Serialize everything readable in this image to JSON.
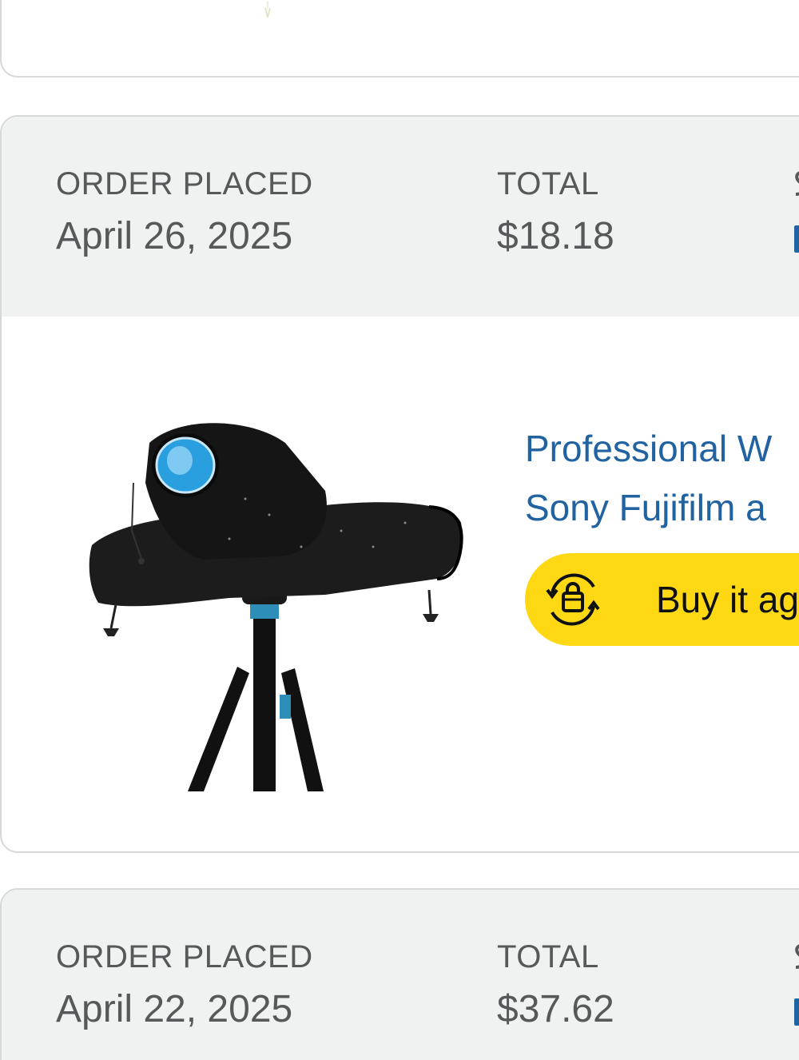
{
  "orders": [
    {
      "order_placed_label": "ORDER PLACED",
      "order_date": "April 26, 2025",
      "total_label": "TOTAL",
      "total_value": "$18.18",
      "item": {
        "title_line1": "Professional W",
        "title_line2": "Sony Fujifilm a",
        "image_icon": "camera-rain-cover-on-tripod",
        "buy_again_label": "Buy it ag",
        "buy_again_icon": "buy-again-bag-refresh-icon"
      }
    },
    {
      "order_placed_label": "ORDER PLACED",
      "order_date": "April 22, 2025",
      "total_label": "TOTAL",
      "total_value": "$37.62"
    }
  ],
  "colors": {
    "header_bg": "#f0f2f2",
    "link": "#2162a1",
    "buy_again_bg": "#ffd814",
    "label_text": "#565959",
    "card_border": "#d5d9d9"
  }
}
